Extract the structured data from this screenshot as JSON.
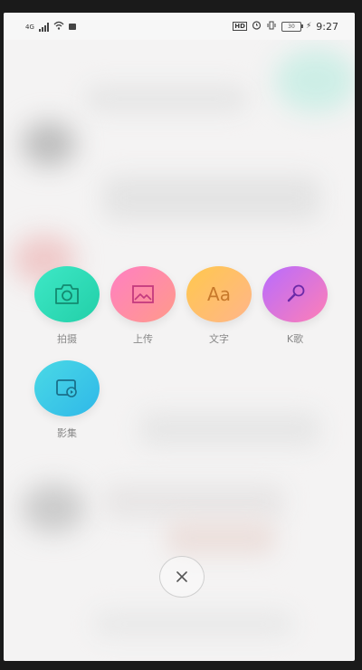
{
  "status_bar": {
    "time": "9:27",
    "network_label": "4G",
    "hd_label": "HD",
    "battery_label": "30"
  },
  "actions": [
    {
      "label": "拍摄",
      "icon": "camera-icon",
      "color": "#2ddcb6"
    },
    {
      "label": "上传",
      "icon": "image-icon",
      "color": "#ff8ab0"
    },
    {
      "label": "文字",
      "icon": "text-aa-icon",
      "color": "#ffc15f",
      "glyph": "Aa"
    },
    {
      "label": "K歌",
      "icon": "microphone-icon",
      "color": "#c06cf2"
    },
    {
      "label": "影集",
      "icon": "photo-album-icon",
      "color": "#3fcbe7"
    }
  ],
  "close": {
    "icon": "close-icon"
  }
}
